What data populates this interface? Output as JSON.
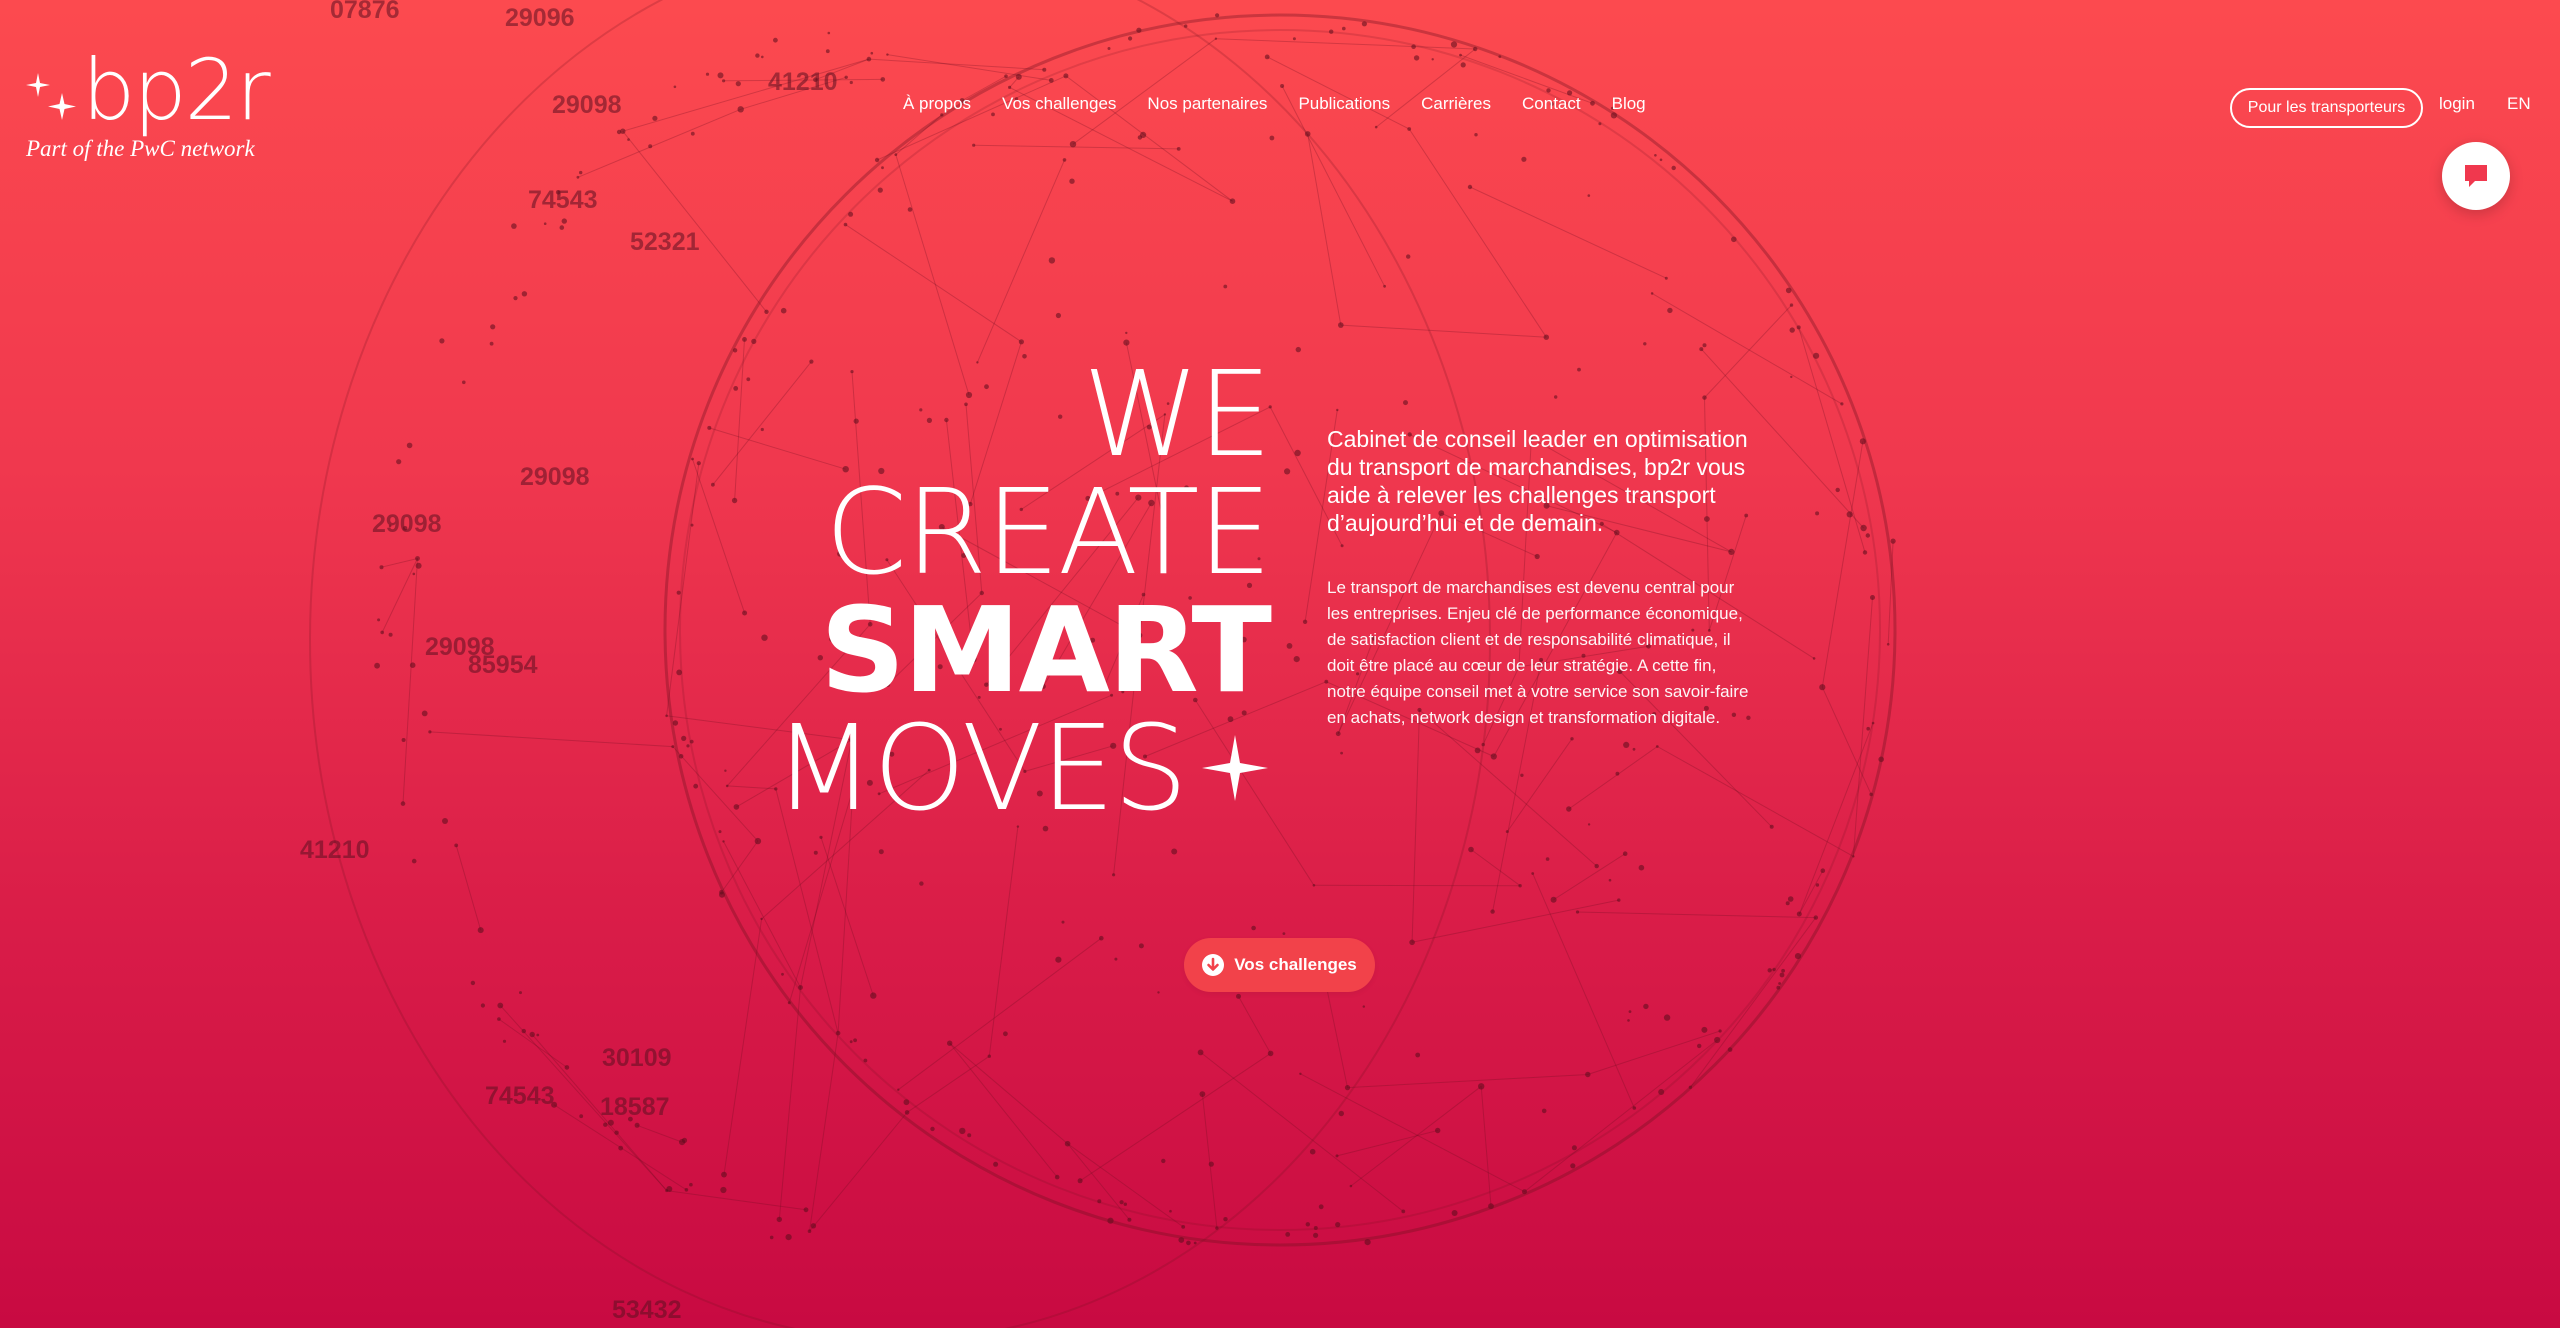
{
  "brand": {
    "name": "bp2r",
    "tagline": "Part of the PwC network"
  },
  "nav": {
    "items": [
      "À propos",
      "Vos challenges",
      "Nos partenaires",
      "Publications",
      "Carrières",
      "Contact",
      "Blog"
    ]
  },
  "header": {
    "carriers_button": "Pour les transporteurs",
    "login": "login",
    "language": "EN"
  },
  "hero": {
    "title_line1": "WE",
    "title_line2": "CREATE",
    "title_line3": "SMART",
    "title_line4": "MOVES",
    "lead": "Cabinet de conseil leader en optimisation du transport de marchandises, bp2r vous aide à relever les challenges transport d’aujourd’hui et de demain.",
    "body": "Le transport de marchandises est devenu central pour les entreprises. Enjeu clé de performance économique, de satisfaction client et de responsabilité climatique, il doit être placé au cœur de leur stratégie. A cette fin, notre équipe conseil met à votre service son savoir-faire en achats, network design et transformation digitale.",
    "cta_label": "Vos challenges"
  },
  "background_labels": [
    "07876",
    "29096",
    "41210",
    "29098",
    "74543",
    "52321",
    "29098",
    "29098",
    "29098",
    "85954",
    "41210",
    "30109",
    "74543",
    "18587",
    "53432"
  ],
  "colors": {
    "accent": "#f2424a",
    "gradient_top": "#fc4a4f",
    "gradient_bottom": "#c80a42"
  },
  "icons": {
    "chat": "chat-bubble-icon",
    "cta": "arrow-down-circle-icon",
    "logo": "sparkle-stars-icon"
  }
}
